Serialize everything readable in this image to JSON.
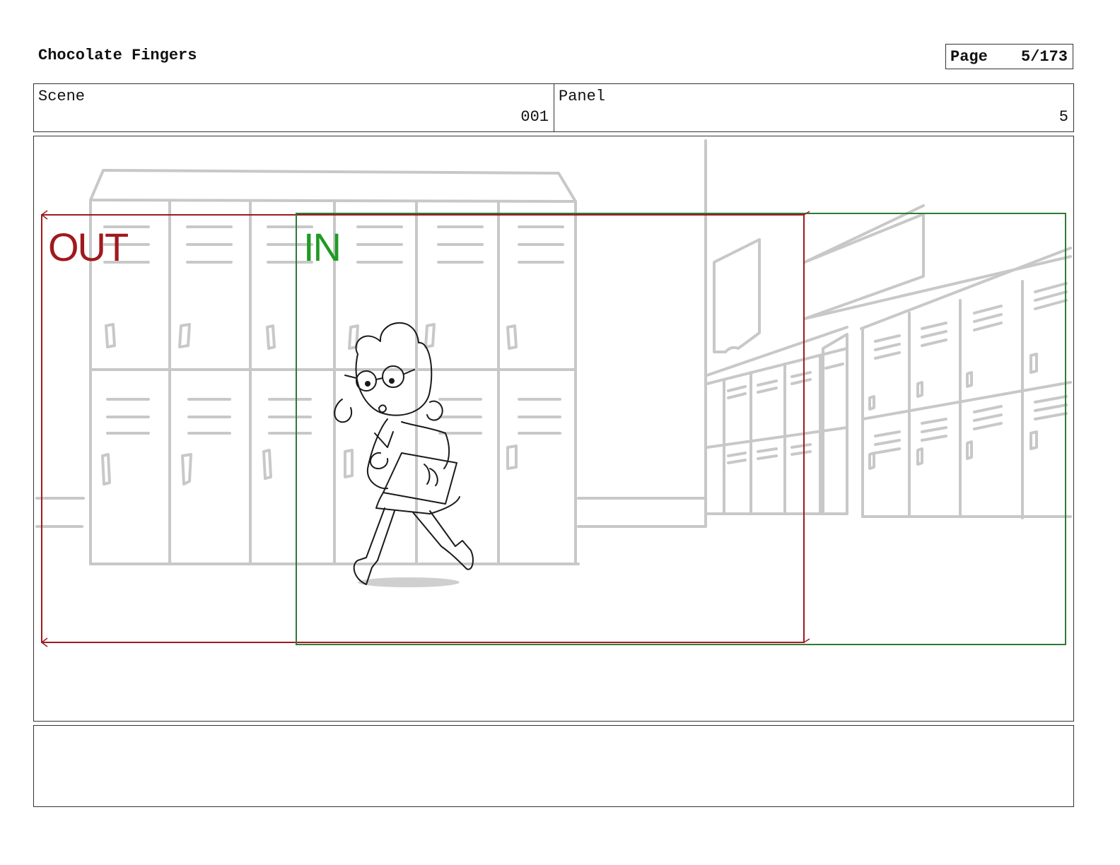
{
  "header": {
    "title": "Chocolate Fingers",
    "page_label": "Page",
    "page_value": "5/173"
  },
  "info": {
    "scene_label": "Scene",
    "scene_value": "001",
    "panel_label": "Panel",
    "panel_value": "5"
  },
  "frame": {
    "out_label": "OUT",
    "in_label": "IN",
    "out_color": "#a0191e",
    "in_color": "#1f9a24",
    "sketch_color": "#c8c8c8",
    "ink_color": "#1a1a1a"
  },
  "notes": {
    "text": ""
  }
}
